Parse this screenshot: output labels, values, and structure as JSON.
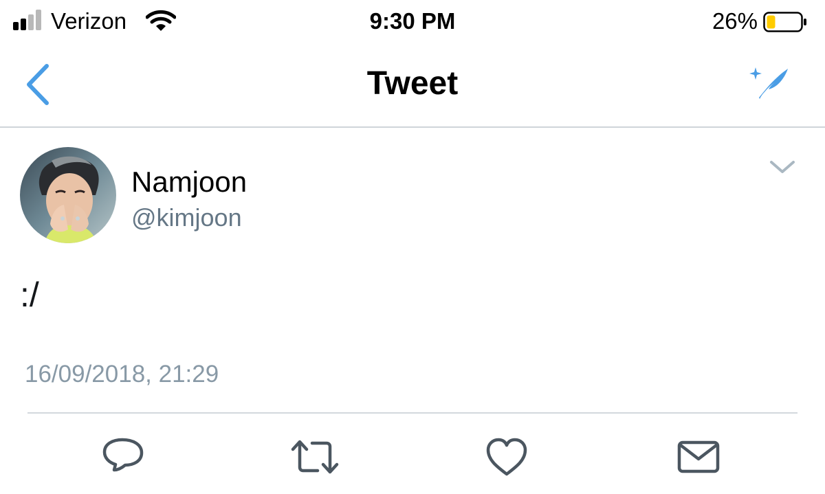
{
  "status_bar": {
    "carrier": "Verizon",
    "time": "9:30 PM",
    "battery_percent": "26%",
    "battery_level": 0.26,
    "signal_bars_active": 2,
    "signal_bars_total": 4,
    "colors": {
      "battery_fill": "#ffcc00"
    }
  },
  "nav": {
    "title": "Tweet",
    "back_icon": "chevron-left-icon",
    "compose_icon": "sparkle-feather-icon"
  },
  "tweet": {
    "display_name": "Namjoon",
    "handle": "@kimjoon",
    "text": ":/",
    "timestamp": "16/09/2018, 21:29",
    "more_icon": "chevron-down-icon"
  },
  "actions": [
    {
      "icon": "reply-icon"
    },
    {
      "icon": "retweet-icon"
    },
    {
      "icon": "like-icon"
    },
    {
      "icon": "share-icon"
    }
  ],
  "colors": {
    "accent": "#4a9de5",
    "icon_gray": "#657786",
    "secondary_text": "#8899a6",
    "divider": "#d3d8dd"
  }
}
